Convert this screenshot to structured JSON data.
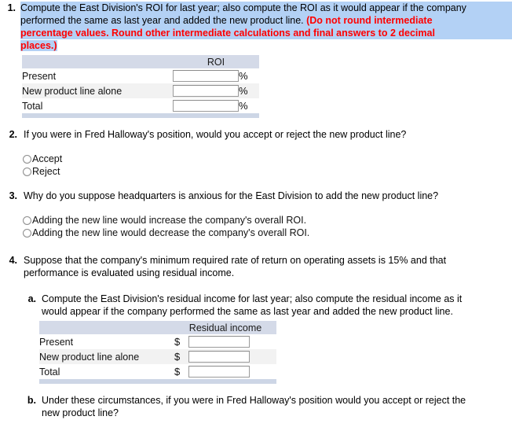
{
  "question1": {
    "number": "1.",
    "text_plain": "Compute the East Division's ROI for last year; also compute the ROI as it would appear if the company performed the same as last year and added the new product line.",
    "text_red": "(Do not round intermediate percentage values. Round other intermediate calculations and final answers to 2 decimal places.)",
    "line1": "Compute the East Division's ROI for last year; also compute the ROI as it would appear if the company",
    "line2_plain": "performed the same as last year and added the new product line. ",
    "line2_red": "(Do not round intermediate",
    "line3_red": "percentage values. Round other intermediate calculations and final answers to 2 decimal",
    "line4_red": "places.)"
  },
  "roi_table": {
    "header": "ROI",
    "rows": [
      {
        "label": "Present",
        "value": "",
        "unit": "%"
      },
      {
        "label": "New product line alone",
        "value": "",
        "unit": "%"
      },
      {
        "label": "Total",
        "value": "",
        "unit": "%"
      }
    ]
  },
  "question2": {
    "number": "2.",
    "text": "If you were in Fred Halloway's position, would you accept or reject the new product line?",
    "options": [
      {
        "label": "Accept",
        "selected": false
      },
      {
        "label": "Reject",
        "selected": false
      }
    ]
  },
  "question3": {
    "number": "3.",
    "text": "Why do you suppose headquarters is anxious for the East Division to add the new product line?",
    "options": [
      {
        "label": "Adding the new line would increase the company's overall ROI.",
        "selected": false
      },
      {
        "label": "Adding the new line would decrease the company's overall ROI.",
        "selected": false
      }
    ]
  },
  "question4": {
    "number": "4.",
    "line1": "Suppose that the company's minimum required rate of return on operating assets is 15% and that",
    "line2": "performance is evaluated using residual income.",
    "parts": [
      {
        "letter": "a.",
        "line1": "Compute the East Division's residual income for last year; also compute the residual income as it",
        "line2": "would appear if the company performed the same as last year and added the new product line."
      },
      {
        "letter": "b.",
        "line1": "Under these circumstances, if you were in Fred Halloway's position would you accept or reject the",
        "line2": "new product line?"
      }
    ]
  },
  "residual_table": {
    "header": "Residual income",
    "rows": [
      {
        "label": "Present",
        "currency": "$",
        "value": ""
      },
      {
        "label": "New product line alone",
        "currency": "$",
        "value": ""
      },
      {
        "label": "Total",
        "currency": "$",
        "value": ""
      }
    ]
  },
  "colors": {
    "highlight": "#b3d1f5",
    "emphasis": "#ff0000",
    "table_header": "#d4dae8",
    "table_footer": "#cdd6e6",
    "row_alt": "#f2f2f2"
  },
  "inputs": {
    "placeholder": ""
  }
}
